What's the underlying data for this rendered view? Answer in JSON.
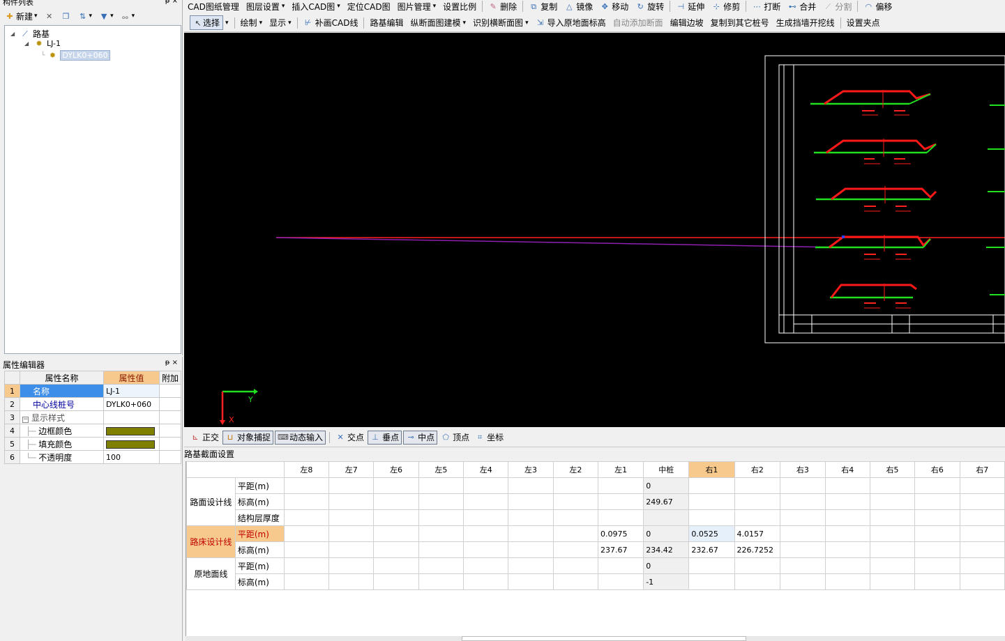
{
  "left_panel": {
    "title": "构件列表",
    "pin": "ᵽ",
    "close": "×",
    "toolbar": {
      "new_label": "新建",
      "new_arrow": "▾"
    },
    "tree": {
      "root": "路基",
      "child": "LJ-1",
      "leaf": "DYLK0+060"
    }
  },
  "prop_panel": {
    "title": "属性编辑器",
    "pin": "ᵽ",
    "close": "×",
    "headers": [
      "属性名称",
      "属性值",
      "附加"
    ],
    "rows": [
      {
        "n": "1",
        "name": "名称",
        "value": "LJ-1"
      },
      {
        "n": "2",
        "name": "中心线桩号",
        "value": "DYLK0+060"
      },
      {
        "n": "3",
        "name": "显示样式",
        "value": ""
      },
      {
        "n": "4",
        "name": "边框颜色",
        "value": ""
      },
      {
        "n": "5",
        "name": "填充颜色",
        "value": ""
      },
      {
        "n": "6",
        "name": "不透明度",
        "value": "100"
      }
    ],
    "swatch_color": "#808000"
  },
  "toolbar1": {
    "items": [
      "CAD图纸管理",
      "图层设置",
      "插入CAD图",
      "定位CAD图",
      "图片管理",
      "设置比例",
      "删除",
      "复制",
      "镜像",
      "移动",
      "旋转",
      "延伸",
      "修剪",
      "打断",
      "合并",
      "分割",
      "偏移"
    ]
  },
  "toolbar2": {
    "items": [
      "选择",
      "绘制",
      "显示",
      "补画CAD线",
      "路基编辑",
      "纵断面图建模",
      "识别横断面图",
      "导入原地面标高",
      "自动添加断面",
      "编辑边坡",
      "复制到其它桩号",
      "生成挡墙开挖线",
      "设置夹点"
    ]
  },
  "snapbar": {
    "items": [
      "正交",
      "对象捕捉",
      "动态输入",
      "交点",
      "垂点",
      "中点",
      "顶点",
      "坐标"
    ]
  },
  "canvas": {
    "axis_y": "Y",
    "axis_x": "X"
  },
  "grid": {
    "title": "路基截面设置",
    "columns": [
      "左8",
      "左7",
      "左6",
      "左5",
      "左4",
      "左3",
      "左2",
      "左1",
      "中桩",
      "右1",
      "右2",
      "右3",
      "右4",
      "右5",
      "右6",
      "右7"
    ],
    "groups": [
      {
        "name": "路面设计线",
        "rows": [
          {
            "label": "平距(m)",
            "values": [
              "",
              "",
              "",
              "",
              "",
              "",
              "",
              "",
              "0",
              "",
              "",
              "",
              "",
              "",
              "",
              ""
            ]
          },
          {
            "label": "标高(m)",
            "values": [
              "",
              "",
              "",
              "",
              "",
              "",
              "",
              "",
              "249.67",
              "",
              "",
              "",
              "",
              "",
              "",
              ""
            ]
          },
          {
            "label": "结构层厚度",
            "values": [
              "",
              "",
              "",
              "",
              "",
              "",
              "",
              "",
              "",
              "",
              "",
              "",
              "",
              "",
              "",
              ""
            ]
          }
        ]
      },
      {
        "name": "路床设计线",
        "rows": [
          {
            "label": "平距(m)",
            "values": [
              "",
              "",
              "",
              "",
              "",
              "",
              "",
              "0.0975",
              "0",
              "0.0525",
              "4.0157",
              "",
              "",
              "",
              "",
              ""
            ]
          },
          {
            "label": "标高(m)",
            "values": [
              "",
              "",
              "",
              "",
              "",
              "",
              "",
              "237.67",
              "234.42",
              "232.67",
              "226.7252",
              "",
              "",
              "",
              "",
              ""
            ]
          }
        ]
      },
      {
        "name": "原地面线",
        "rows": [
          {
            "label": "平距(m)",
            "values": [
              "",
              "",
              "",
              "",
              "",
              "",
              "",
              "",
              "0",
              "",
              "",
              "",
              "",
              "",
              "",
              ""
            ]
          },
          {
            "label": "标高(m)",
            "values": [
              "",
              "",
              "",
              "",
              "",
              "",
              "",
              "",
              "-1",
              "",
              "",
              "",
              "",
              "",
              "",
              ""
            ]
          }
        ]
      }
    ]
  }
}
